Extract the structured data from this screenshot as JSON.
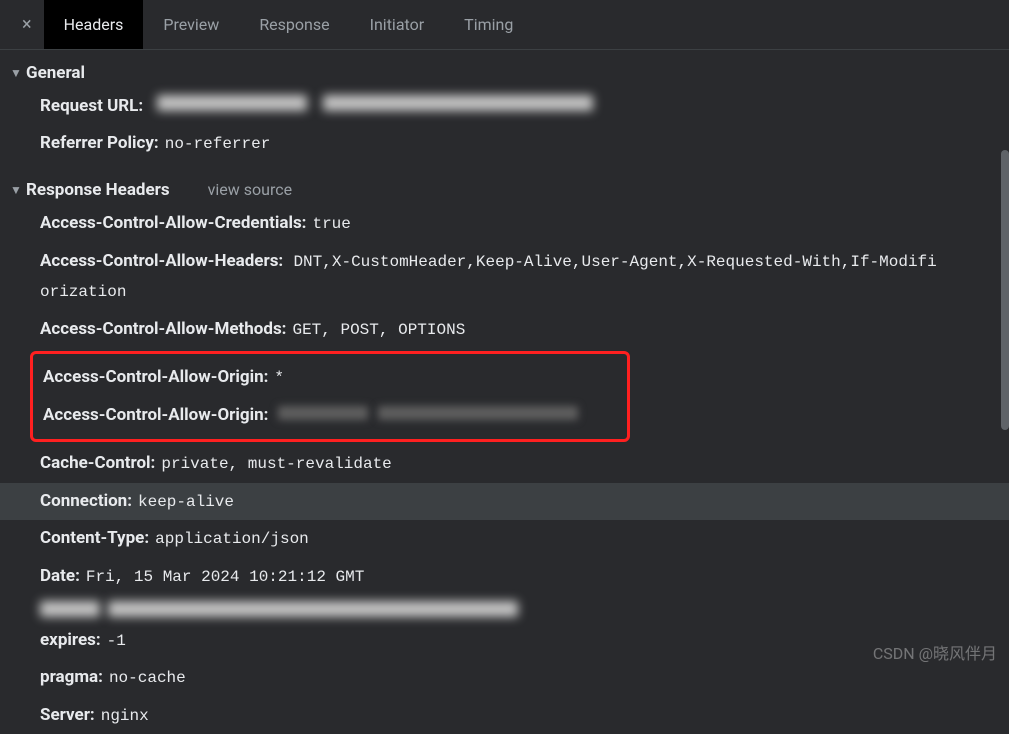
{
  "tabs": {
    "headers": "Headers",
    "preview": "Preview",
    "response": "Response",
    "initiator": "Initiator",
    "timing": "Timing"
  },
  "sections": {
    "general": {
      "title": "General",
      "request_url_label": "Request URL:",
      "referrer_policy_label": "Referrer Policy:",
      "referrer_policy_value": "no-referrer"
    },
    "response_headers": {
      "title": "Response Headers",
      "view_source": "view source",
      "headers": {
        "ac_allow_credentials_label": "Access-Control-Allow-Credentials:",
        "ac_allow_credentials_value": "true",
        "ac_allow_headers_label": "Access-Control-Allow-Headers:",
        "ac_allow_headers_value": "DNT,X-CustomHeader,Keep-Alive,User-Agent,X-Requested-With,If-Modifi",
        "ac_allow_headers_wrap": "orization",
        "ac_allow_methods_label": "Access-Control-Allow-Methods:",
        "ac_allow_methods_value": "GET, POST, OPTIONS",
        "ac_allow_origin1_label": "Access-Control-Allow-Origin:",
        "ac_allow_origin1_value": "*",
        "ac_allow_origin2_label": "Access-Control-Allow-Origin:",
        "cache_control_label": "Cache-Control:",
        "cache_control_value": "private, must-revalidate",
        "connection_label": "Connection:",
        "connection_value": "keep-alive",
        "content_type_label": "Content-Type:",
        "content_type_value": "application/json",
        "date_label": "Date:",
        "date_value": "Fri, 15 Mar 2024 10:21:12 GMT",
        "expires_label": "expires:",
        "expires_value": "-1",
        "pragma_label": "pragma:",
        "pragma_value": "no-cache",
        "server_label": "Server:",
        "server_value": "nginx"
      }
    }
  },
  "watermark": "CSDN @晓风伴月"
}
